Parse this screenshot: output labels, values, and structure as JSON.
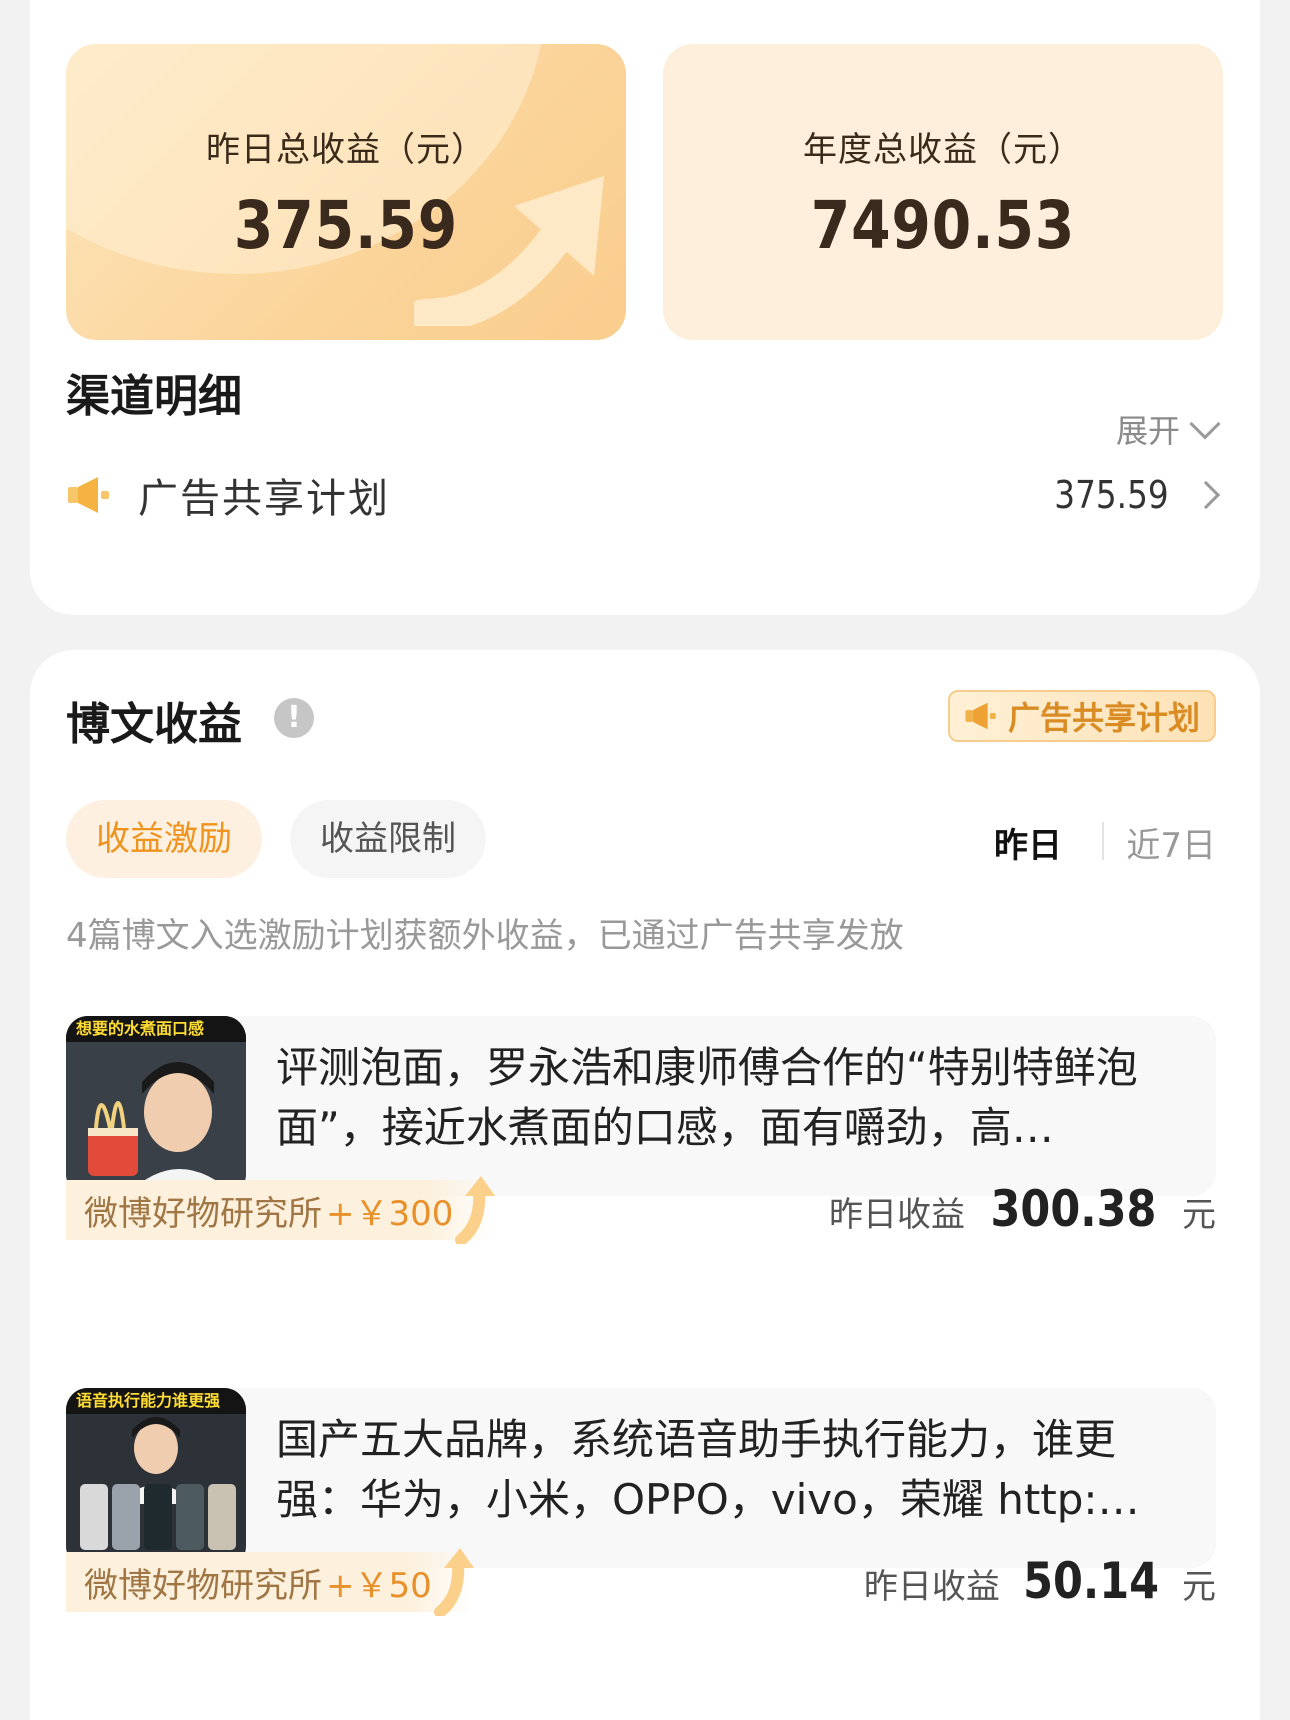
{
  "earnings": {
    "yesterday_label": "昨日总收益（元）",
    "yesterday_value": "375.59",
    "annual_label": "年度总收益（元）",
    "annual_value": "7490.53"
  },
  "channel": {
    "title": "渠道明细",
    "expand_label": "展开",
    "rows": [
      {
        "icon": "megaphone-icon",
        "label": "广告共享计划",
        "amount": "375.59"
      }
    ]
  },
  "blog": {
    "title": "博文收益",
    "badge_label": "广告共享计划",
    "tabs": [
      {
        "label": "收益激励",
        "active": true
      },
      {
        "label": "收益限制",
        "active": false
      }
    ],
    "periods": [
      {
        "label": "昨日",
        "active": true
      },
      {
        "label": "近7日",
        "active": false
      }
    ],
    "note": "4篇博文入选激励计划获额外收益，已通过广告共享发放",
    "posts": [
      {
        "thumb_caption": "想要的水煮面口感",
        "title": "评测泡面，罗永浩和康师傅合作的“特别特鲜泡面”，接近水煮面的口感，面有嚼劲，高…",
        "reward_source": "微博好物研究所",
        "reward_amount": "+￥300",
        "earn_label": "昨日收益",
        "earn_value": "300.38",
        "earn_unit": "元"
      },
      {
        "thumb_caption": "语音执行能力谁更强",
        "title": "国产五大品牌，系统语音助手执行能力，谁更强：华为，小米，OPPO，vivo，荣耀 http:…",
        "reward_source": "微博好物研究所",
        "reward_amount": "+￥50",
        "earn_label": "昨日收益",
        "earn_value": "50.14",
        "earn_unit": "元"
      }
    ]
  },
  "colors": {
    "accent": "#f0931c",
    "badge_text": "#d98b24",
    "earn_box_left": "#fbd49a",
    "earn_box_right": "#fdefdc"
  }
}
